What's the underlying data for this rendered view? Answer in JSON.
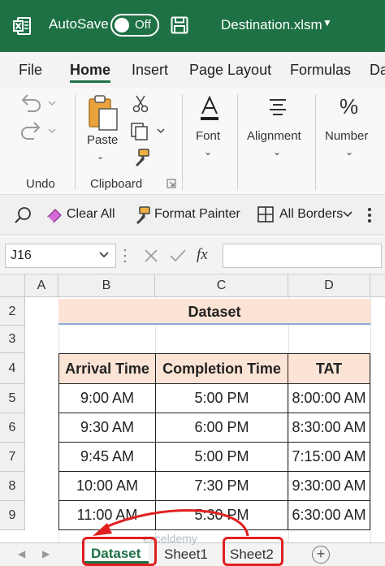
{
  "titlebar": {
    "autosave_label": "AutoSave",
    "toggle_state": "Off",
    "file_name": "Destination.xlsm",
    "background": "#1e7145"
  },
  "tabs": [
    {
      "label": "File",
      "active": false
    },
    {
      "label": "Home",
      "active": true
    },
    {
      "label": "Insert",
      "active": false
    },
    {
      "label": "Page Layout",
      "active": false
    },
    {
      "label": "Formulas",
      "active": false
    },
    {
      "label": "Da",
      "active": false
    }
  ],
  "ribbon": {
    "undo_group": "Undo",
    "paste": "Paste",
    "clipboard_group": "Clipboard",
    "font": "Font",
    "alignment": "Alignment",
    "number": "Number"
  },
  "quickbar": {
    "clear_all": "Clear All",
    "format_painter": "Format Painter",
    "all_borders": "All Borders"
  },
  "formula_bar": {
    "name_box": "J16",
    "fx": "fx",
    "value": ""
  },
  "grid": {
    "columns": [
      "A",
      "B",
      "C",
      "D"
    ],
    "rows": [
      "2",
      "3",
      "4",
      "5",
      "6",
      "7",
      "8",
      "9"
    ],
    "title": "Dataset",
    "headers": [
      "Arrival Time",
      "Completion Time",
      "TAT"
    ],
    "records": [
      [
        "9:00 AM",
        "5:00 PM",
        "8:00:00 AM"
      ],
      [
        "9:30 AM",
        "6:00 PM",
        "8:30:00 AM"
      ],
      [
        "9:45 AM",
        "5:00 PM",
        "7:15:00 AM"
      ],
      [
        "10:00 AM",
        "7:30 PM",
        "9:30:00 AM"
      ],
      [
        "11:00 AM",
        "5:30 PM",
        "6:30:00 AM"
      ]
    ]
  },
  "sheets": {
    "tabs": [
      "Dataset",
      "Sheet1",
      "Sheet2"
    ],
    "active": "Dataset",
    "add": "+"
  },
  "watermark": "exceldemy",
  "colors": {
    "accent": "#1e7145",
    "header_fill": "#fbe4d5",
    "annotation": "#e02020"
  }
}
